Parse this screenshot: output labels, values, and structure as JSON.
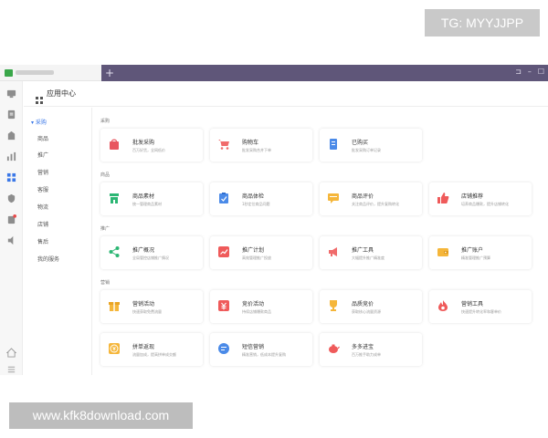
{
  "watermarks": {
    "top": "TG: MYYJJPP",
    "bottom": "www.kfk8download.com"
  },
  "titlebar": {
    "new_tab_symbol": "+",
    "controls": [
      "⊐",
      "–",
      "☐"
    ]
  },
  "header": {
    "title": "应用中心"
  },
  "nav": {
    "group": "采购",
    "items": [
      "商品",
      "推广",
      "营销",
      "客服",
      "物流",
      "店铺",
      "售后",
      "我的服务"
    ]
  },
  "sections": [
    {
      "label": "采购",
      "cards": [
        {
          "title": "批发采购",
          "desc": "百万好货，全网低价",
          "icon": "bag-icon",
          "color": "#e8565f"
        },
        {
          "title": "购物车",
          "desc": "批发采购合并下单",
          "icon": "cart-icon",
          "color": "#f06b6b"
        },
        {
          "title": "已购买",
          "desc": "批发采购订单记录",
          "icon": "document-icon",
          "color": "#4a8ae8"
        }
      ]
    },
    {
      "label": "商品",
      "cards": [
        {
          "title": "商品素材",
          "desc": "统一管理商品素材",
          "icon": "store-icon",
          "color": "#2bb673"
        },
        {
          "title": "商品体检",
          "desc": "1秒定位商品问题",
          "icon": "clipboard-icon",
          "color": "#4a8ae8"
        },
        {
          "title": "商品评价",
          "desc": "关注商品评价，提升复购转化",
          "icon": "chat-icon",
          "color": "#f5b63a"
        },
        {
          "title": "店铺推荐",
          "desc": "培养商品爆款，提升店铺转化",
          "icon": "thumb-icon",
          "color": "#ef5a5a"
        }
      ]
    },
    {
      "label": "推广",
      "cards": [
        {
          "title": "推广概况",
          "desc": "全局管控店铺推广情况",
          "icon": "share-icon",
          "color": "#2bb673"
        },
        {
          "title": "推广计划",
          "desc": "高效管理推广投放",
          "icon": "chart-icon",
          "color": "#ef5a5a"
        },
        {
          "title": "推广工具",
          "desc": "大幅提升推广精准度",
          "icon": "megaphone-icon",
          "color": "#f06b6b"
        },
        {
          "title": "推广账户",
          "desc": "精准管理推广预算",
          "icon": "wallet-icon",
          "color": "#f5b63a"
        }
      ]
    },
    {
      "label": "营销",
      "cards": [
        {
          "title": "营销活动",
          "desc": "快速获取免费流量",
          "icon": "gift-icon",
          "color": "#f5b63a"
        },
        {
          "title": "竞价活动",
          "desc": "持续店铺爆款商品",
          "icon": "tag-icon",
          "color": "#ef5a5a"
        },
        {
          "title": "品质竞价",
          "desc": "获取核心流量资源",
          "icon": "trophy-icon",
          "color": "#f5b63a"
        },
        {
          "title": "营销工具",
          "desc": "快速提升转化率和客单价",
          "icon": "flame-icon",
          "color": "#ef5a5a"
        }
      ]
    },
    {
      "label": "",
      "cards": [
        {
          "title": "拼单返现",
          "desc": "流量加成，提高拼单成交额",
          "icon": "coin-icon",
          "color": "#f5b63a"
        },
        {
          "title": "短信营销",
          "desc": "精准营销，低成本提升复购",
          "icon": "message-icon",
          "color": "#4a8ae8"
        },
        {
          "title": "多多进宝",
          "desc": "百万推手助力成单",
          "icon": "teapot-icon",
          "color": "#ef5a5a"
        }
      ]
    }
  ]
}
